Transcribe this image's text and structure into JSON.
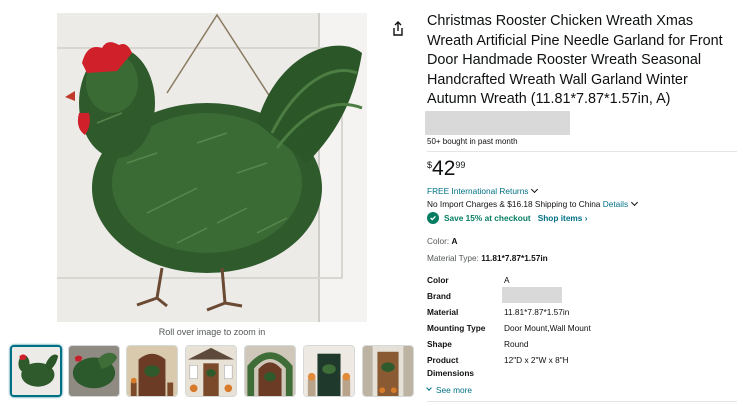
{
  "product": {
    "title": "Christmas Rooster Chicken Wreath Xmas Wreath Artificial Pine Needle Garland for Front Door Handmade Rooster Wreath Seasonal Handcrafted Wreath Wall Garland Winter Autumn Wreath (11.81*7.87*1.57in, A)",
    "bought": "50+ bought in past month",
    "price": {
      "symbol": "$",
      "whole": "42",
      "fraction": "99"
    },
    "returns": "FREE International Returns",
    "shipping_text": "No Import Charges & $16.18 Shipping to China",
    "shipping_link": "Details",
    "save_text": "Save 15% at checkout",
    "shop_items": "Shop items ›",
    "color_label": "Color:",
    "color_value": "A",
    "material_label": "Material Type:",
    "material_value": "11.81*7.87*1.57in"
  },
  "specs": [
    {
      "key": "Color",
      "value": "A"
    },
    {
      "key": "Brand",
      "value": ""
    },
    {
      "key": "Material",
      "value": "11.81*7.87*1.57in"
    },
    {
      "key": "Mounting Type",
      "value": "Door Mount,Wall Mount"
    },
    {
      "key": "Shape",
      "value": "Round"
    },
    {
      "key": "Product Dimensions",
      "value": "12\"D x 2\"W x 8\"H"
    }
  ],
  "see_more": "See more",
  "gallery": {
    "zoom_hint": "Roll over image to zoom in",
    "selected_index": 0,
    "thumb_icons": [
      "rooster-wreath-thumb",
      "wreath-closeup-thumb",
      "door-wreath-thumb",
      "porch-thumb",
      "arch-garland-thumb",
      "door-thumb",
      "door-pillar-thumb"
    ]
  },
  "colors": {
    "link": "#007185",
    "save_green": "#067d62",
    "wreath_green": "#2f5a2c",
    "comb_red": "#d0202a"
  }
}
